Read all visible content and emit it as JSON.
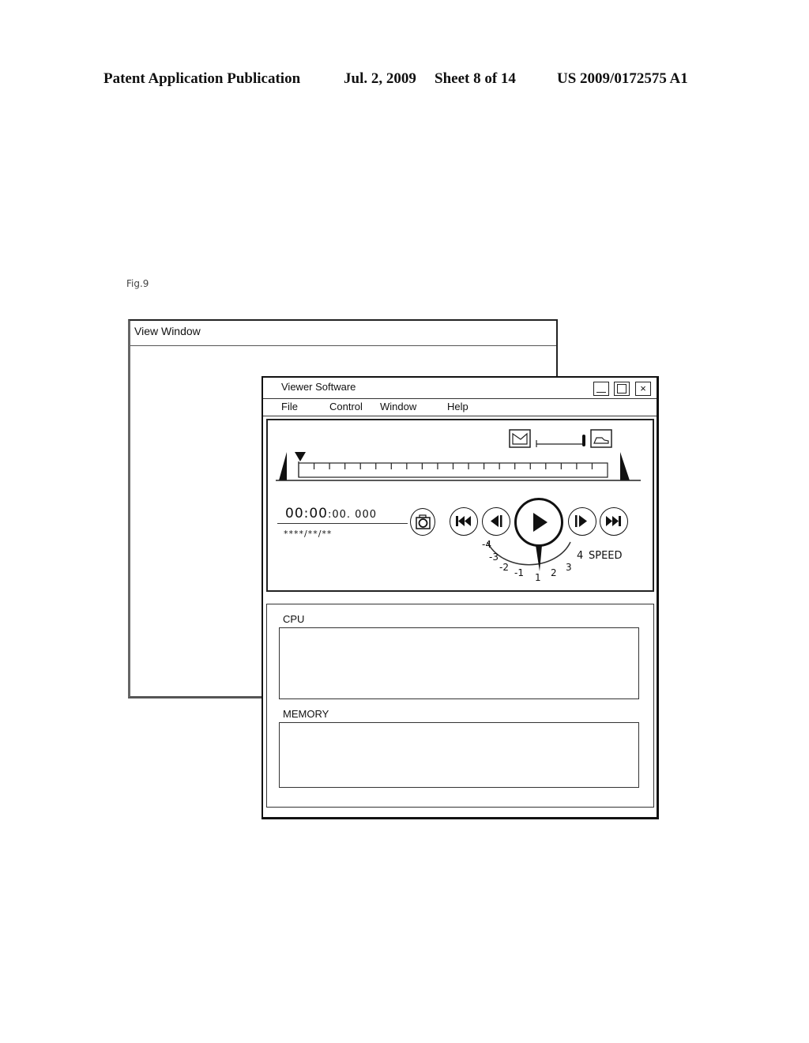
{
  "patent_header": {
    "publication": "Patent Application Publication",
    "date": "Jul. 2, 2009",
    "sheet": "Sheet 8 of 14",
    "number": "US 2009/0172575 A1"
  },
  "figure_label": "Fig.9",
  "view_window": {
    "title": "View  Window"
  },
  "viewer_window": {
    "title": "Viewer Software",
    "window_buttons": {
      "minimize": "minimize-icon",
      "maximize": "maximize-icon",
      "close": "×"
    },
    "menu": [
      "File",
      "Control",
      "Window",
      "Help"
    ],
    "timeline": {
      "tick_count": 19,
      "position_marker": 0
    },
    "zoom_slider": {
      "left_icon": "zoom-out-graph-icon",
      "right_icon": "zoom-in-graph-icon",
      "value": 1.0
    },
    "timecode": {
      "main": "00:00",
      "sub": ":00. 000"
    },
    "date": "****/**/**",
    "buttons": {
      "snapshot": "camera-icon",
      "skip_back": "skip-to-start-icon",
      "step_back": "step-back-icon",
      "play": "play-icon",
      "step_forward": "step-forward-icon",
      "skip_forward": "skip-to-end-icon"
    },
    "speed": {
      "label": "SPEED",
      "ticks": [
        "-4",
        "-3",
        "-2",
        "-1",
        "1",
        "2",
        "3",
        "4"
      ],
      "current": "1"
    },
    "panels": [
      {
        "label": "CPU"
      },
      {
        "label": "MEMORY"
      }
    ]
  }
}
